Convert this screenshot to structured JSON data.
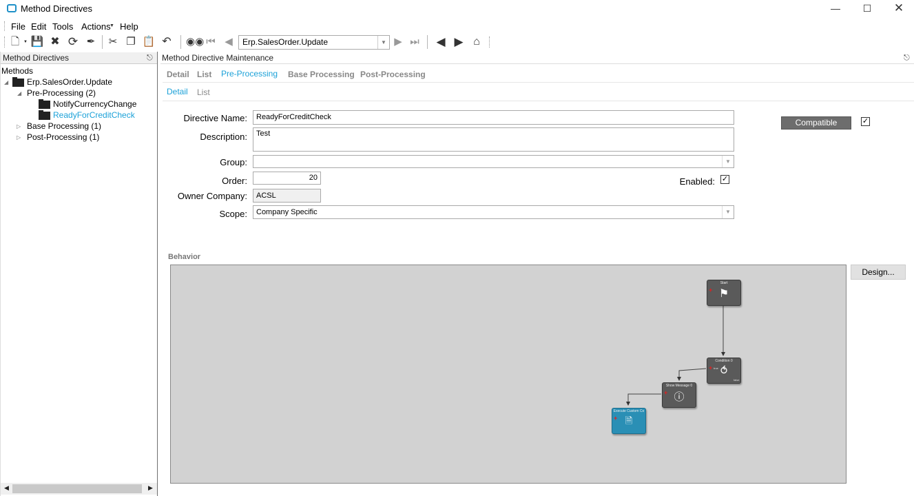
{
  "window": {
    "title": "Method Directives"
  },
  "menu": [
    "File",
    "Edit",
    "Tools",
    "Actions",
    "Help"
  ],
  "toolbar": {
    "method_value": "Erp.SalesOrder.Update"
  },
  "left_panel": {
    "title": "Method Directives",
    "tree": {
      "root": "Methods",
      "method": "Erp.SalesOrder.Update",
      "pre_processing": "Pre-Processing (2)",
      "directive_1": "NotifyCurrencyChange",
      "directive_2": "ReadyForCreditCheck",
      "base_processing": "Base Processing (1)",
      "post_processing": "Post-Processing (1)"
    }
  },
  "right_panel": {
    "title": "Method Directive Maintenance",
    "tabs": [
      "Detail",
      "List",
      "Pre-Processing",
      "Base Processing",
      "Post-Processing"
    ],
    "subtabs": [
      "Detail",
      "List"
    ],
    "form": {
      "directive_name_label": "Directive Name:",
      "directive_name": "ReadyForCreditCheck",
      "description_label": "Description:",
      "description": "Test",
      "group_label": "Group:",
      "group": "",
      "order_label": "Order:",
      "order": "20",
      "owner_company_label": "Owner Company:",
      "owner_company": "ACSL",
      "scope_label": "Scope:",
      "scope": "Company Specific",
      "enabled_label": "Enabled:",
      "enabled": true,
      "compatible_label": "Compatible",
      "compatible": true
    },
    "behavior": {
      "label": "Behavior",
      "design_button": "Design...",
      "nodes": {
        "start": "Start",
        "condition": "Condition 0",
        "show_message": "Show Message 0",
        "execute_custom": "Execute Custom Co",
        "condition_true": "true",
        "condition_false": "false"
      }
    }
  },
  "colors": {
    "accent": "#1ba1d8",
    "canvas": "#d2d2d2",
    "node": "#5a5a5a",
    "custom_node": "#2a8fb5"
  }
}
